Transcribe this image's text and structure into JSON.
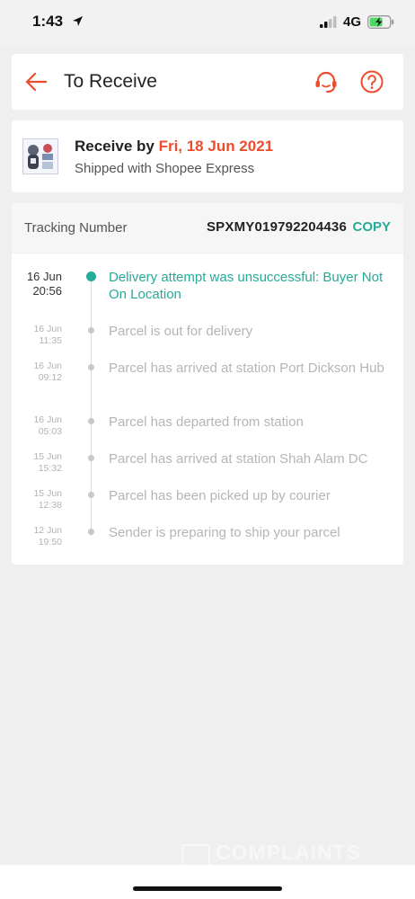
{
  "status_bar": {
    "time": "1:43",
    "network": "4G"
  },
  "header": {
    "title": "To Receive"
  },
  "receive": {
    "prefix": "Receive by ",
    "date": "Fri, 18 Jun 2021",
    "shipped_with": "Shipped with Shopee Express"
  },
  "tracking": {
    "label": "Tracking Number",
    "number": "SPXMY019792204436",
    "copy_label": "COPY",
    "events": [
      {
        "day": "16 Jun",
        "time": "20:56",
        "text": "Delivery attempt was unsuccessful: Buyer Not On Location"
      },
      {
        "day": "16 Jun",
        "time": "11:35",
        "text": "Parcel is out for delivery"
      },
      {
        "day": "16 Jun",
        "time": "09:12",
        "text": "Parcel has arrived at station Port Dickson Hub"
      },
      {
        "day": "16 Jun",
        "time": "05:03",
        "text": "Parcel has departed from station"
      },
      {
        "day": "15 Jun",
        "time": "15:32",
        "text": "Parcel has arrived at station Shah Alam DC"
      },
      {
        "day": "15 Jun",
        "time": "12:38",
        "text": "Parcel has been picked up by courier"
      },
      {
        "day": "12 Jun",
        "time": "19:50",
        "text": "Sender is preparing to ship your parcel"
      }
    ]
  },
  "watermark": {
    "text": "COMPLAINTS"
  },
  "colors": {
    "brand": "#ee4d2d",
    "status_active": "#26aa99"
  }
}
